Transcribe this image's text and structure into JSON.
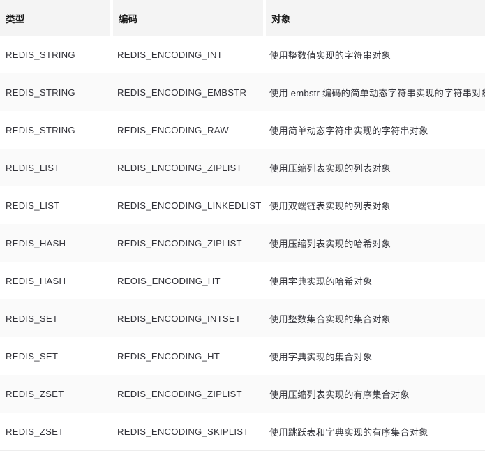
{
  "table": {
    "columns": [
      {
        "key": "type",
        "label": "类型"
      },
      {
        "key": "encoding",
        "label": "编码"
      },
      {
        "key": "object",
        "label": "对象"
      }
    ],
    "rows": [
      {
        "type": "REDIS_STRING",
        "encoding": "REDIS_ENCODING_INT",
        "object": "使用整数值实现的字符串对象"
      },
      {
        "type": "REDIS_STRING",
        "encoding": "REDIS_ENCODING_EMBSTR",
        "object": "使用 embstr 编码的简单动态字符串实现的字符串对象"
      },
      {
        "type": "REDIS_STRING",
        "encoding": "REDIS_ENCODING_RAW",
        "object": "使用简单动态字符串实现的字符串对象"
      },
      {
        "type": "REDIS_LIST",
        "encoding": "REDIS_ENCODING_ZIPLIST",
        "object": "使用压缩列表实现的列表对象"
      },
      {
        "type": "REDIS_LIST",
        "encoding": "REDIS_ENCODING_LINKEDLIST",
        "object": "使用双端链表实现的列表对象"
      },
      {
        "type": "REDIS_HASH",
        "encoding": "REDIS_ENCODING_ZIPLIST",
        "object": "使用压缩列表实现的哈希对象"
      },
      {
        "type": "REDIS_HASH",
        "encoding": "REOIS_ENCODING_HT",
        "object": "使用字典实现的哈希对象"
      },
      {
        "type": "REDIS_SET",
        "encoding": "REDIS_ENCODING_INTSET",
        "object": "使用整数集合实现的集合对象"
      },
      {
        "type": "REDIS_SET",
        "encoding": "REDIS_ENCODING_HT",
        "object": "使用字典实现的集合对象"
      },
      {
        "type": "REDIS_ZSET",
        "encoding": "REDIS_ENCODING_ZIPLIST",
        "object": "使用压缩列表实现的有序集合对象"
      },
      {
        "type": "REDIS_ZSET",
        "encoding": "REDIS_ENCODING_SKIPLIST",
        "object": "使用跳跃表和字典实现的有序集合对象"
      }
    ]
  },
  "colors": {
    "header_bg": "#f4f4f4",
    "row_bg_odd": "#ffffff",
    "row_bg_even": "#fafafa",
    "header_text": "#1a1a1a",
    "body_text": "#33333a",
    "bottom_border": "#ededed"
  }
}
